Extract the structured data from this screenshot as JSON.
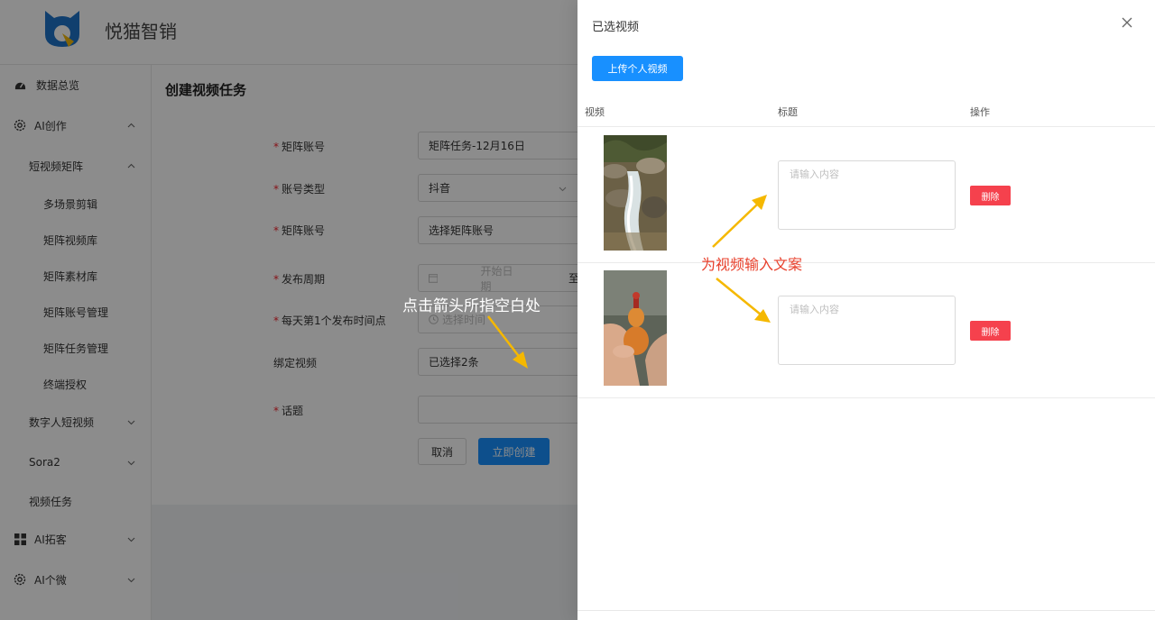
{
  "app": {
    "brand": "悦猫智销"
  },
  "sidebar": {
    "items": [
      {
        "label": "数据总览",
        "icon": "dashboard-icon"
      },
      {
        "label": "AI创作",
        "icon": "gear-icon",
        "expanded": true
      },
      {
        "label": "短视频矩阵",
        "expanded": true
      },
      {
        "label": "多场景剪辑"
      },
      {
        "label": "矩阵视频库"
      },
      {
        "label": "矩阵素材库"
      },
      {
        "label": "矩阵账号管理"
      },
      {
        "label": "矩阵任务管理"
      },
      {
        "label": "终端授权"
      },
      {
        "label": "数字人短视频"
      },
      {
        "label": "Sora2"
      },
      {
        "label": "视频任务"
      },
      {
        "label": "AI拓客",
        "icon": "grid-icon"
      },
      {
        "label": "AI个微",
        "icon": "gear-icon"
      }
    ]
  },
  "form": {
    "title": "创建视频任务",
    "fields": [
      {
        "label": "矩阵账号",
        "required": true,
        "value": "矩阵任务-12月16日"
      },
      {
        "label": "账号类型",
        "required": true,
        "value": "抖音"
      },
      {
        "label": "矩阵账号",
        "required": true,
        "value": "选择矩阵账号"
      },
      {
        "label": "发布周期",
        "required": true,
        "start_placeholder": "开始日期",
        "separator": "至"
      },
      {
        "label": "每天第1个发布时间点",
        "required": true,
        "placeholder": "选择时间"
      },
      {
        "label": "绑定视频",
        "required": false,
        "value": "已选择2条"
      },
      {
        "label": "话题",
        "required": true,
        "value": ""
      }
    ],
    "cancel_label": "取消",
    "create_label": "立即创建"
  },
  "drawer": {
    "title": "已选视频",
    "upload_label": "上传个人视频",
    "columns": [
      "视频",
      "标题",
      "操作"
    ],
    "rows": [
      {
        "thumbnail": "waterfall-stream-photo",
        "title_placeholder": "请输入内容",
        "delete_label": "删除"
      },
      {
        "thumbnail": "gourd-in-hand-photo",
        "title_placeholder": "请输入内容",
        "delete_label": "删除"
      }
    ]
  },
  "annotations": {
    "left_text": "点击箭头所指空白处",
    "right_text": "为视频输入文案",
    "arrow_color": "#f5b800"
  },
  "colors": {
    "primary": "#1890ff",
    "danger": "#f5414d",
    "required": "#f5222d",
    "annotation_red": "#e8402c"
  }
}
